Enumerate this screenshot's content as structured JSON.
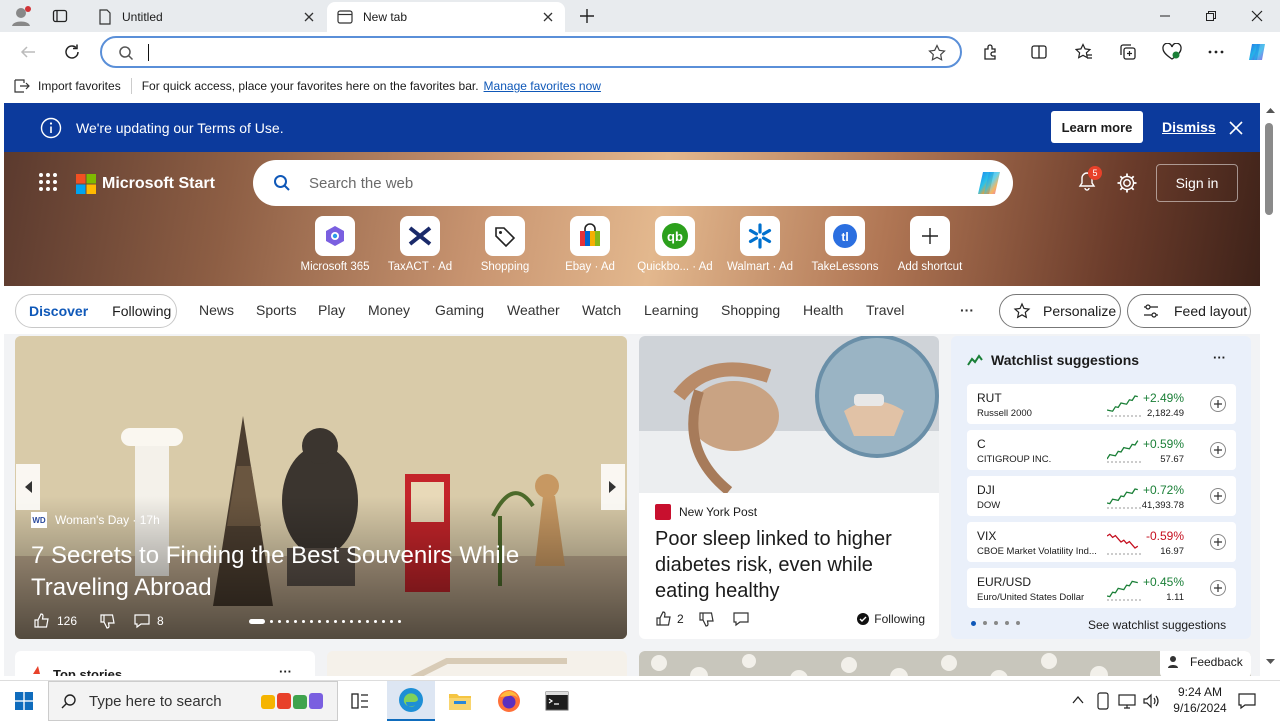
{
  "browser": {
    "tabs": [
      {
        "label": "Untitled"
      },
      {
        "label": "New tab"
      }
    ],
    "favorites_bar": {
      "import_label": "Import favorites",
      "message": "For quick access, place your favorites here on the favorites bar.",
      "manage_link": "Manage favorites now"
    }
  },
  "notice": {
    "text": "We're updating our Terms of Use.",
    "learn_more": "Learn more",
    "dismiss": "Dismiss"
  },
  "header": {
    "brand": "Microsoft Start",
    "search_placeholder": "Search the web",
    "notification_count": "5",
    "sign_in": "Sign in"
  },
  "quick_links": [
    {
      "label": "Microsoft 365"
    },
    {
      "label": "TaxACT · Ad"
    },
    {
      "label": "Shopping"
    },
    {
      "label": "Ebay · Ad"
    },
    {
      "label": "Quickbo... · Ad"
    },
    {
      "label": "Walmart · Ad"
    },
    {
      "label": "TakeLessons"
    },
    {
      "label": "Add shortcut"
    }
  ],
  "nav": {
    "discover": "Discover",
    "following": "Following",
    "items": [
      "News",
      "Sports",
      "Play",
      "Money",
      "Gaming",
      "Weather",
      "Watch",
      "Learning",
      "Shopping",
      "Health",
      "Travel"
    ],
    "more": "···",
    "personalize": "Personalize",
    "feed_layout": "Feed layout"
  },
  "main_story": {
    "source": "Woman's Day · 17h",
    "title": "7 Secrets to Finding the Best Souvenirs While Traveling Abroad",
    "likes": "126",
    "comments": "8"
  },
  "story2": {
    "source": "New York Post",
    "title": "Poor sleep linked to higher diabetes risk, even while eating healthy",
    "likes": "2",
    "following": "Following"
  },
  "watchlist": {
    "title": "Watchlist suggestions",
    "see_more": "See watchlist suggestions",
    "rows": [
      {
        "symbol": "RUT",
        "name": "Russell 2000",
        "change": "+2.49%",
        "price": "2,182.49",
        "up": true
      },
      {
        "symbol": "C",
        "name": "CITIGROUP INC.",
        "change": "+0.59%",
        "price": "57.67",
        "up": true
      },
      {
        "symbol": "DJI",
        "name": "DOW",
        "change": "+0.72%",
        "price": "41,393.78",
        "up": true
      },
      {
        "symbol": "VIX",
        "name": "CBOE Market Volatility Ind...",
        "change": "-0.59%",
        "price": "16.97",
        "up": false
      },
      {
        "symbol": "EUR/USD",
        "name": "Euro/United States Dollar",
        "change": "+0.45%",
        "price": "1.11",
        "up": true
      }
    ]
  },
  "bottom": {
    "top_stories": "Top stories",
    "feedback": "Feedback"
  },
  "taskbar": {
    "search_placeholder": "Type here to search",
    "time": "9:24 AM",
    "date": "9/16/2024"
  },
  "colors": {
    "banner": "#0c3a9c",
    "accent": "#0f58b8",
    "up": "#1a7f37",
    "down": "#c50f1f"
  }
}
